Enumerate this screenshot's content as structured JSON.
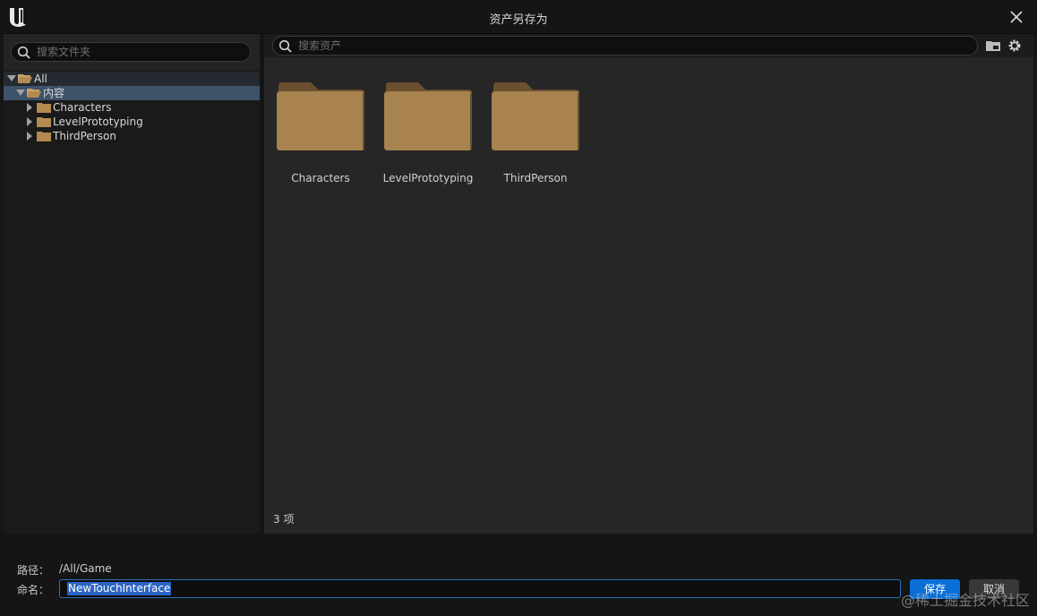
{
  "window": {
    "title": "资产另存为"
  },
  "left": {
    "search_placeholder": "搜索文件夹",
    "tree": [
      {
        "label": "All",
        "depth": 0,
        "expanded": true,
        "selected": false
      },
      {
        "label": "内容",
        "depth": 1,
        "expanded": true,
        "selected": true
      },
      {
        "label": "Characters",
        "depth": 2,
        "expanded": false,
        "selected": false
      },
      {
        "label": "LevelPrototyping",
        "depth": 2,
        "expanded": false,
        "selected": false
      },
      {
        "label": "ThirdPerson",
        "depth": 2,
        "expanded": false,
        "selected": false
      }
    ]
  },
  "right": {
    "search_placeholder": "搜索资产",
    "folders": [
      {
        "label": "Characters"
      },
      {
        "label": "LevelPrototyping"
      },
      {
        "label": "ThirdPerson"
      }
    ],
    "item_count": "3 项"
  },
  "bottom": {
    "path_label": "路径：",
    "path_value": "/All/Game",
    "name_label": "命名：",
    "name_value": "NewTouchInterface",
    "save_label": "保存",
    "cancel_label": "取消",
    "watermark": "@稀土掘金技术社区"
  },
  "colors": {
    "accent": "#0a70d8",
    "selection": "#3d5369",
    "folder": "#a8834f"
  }
}
